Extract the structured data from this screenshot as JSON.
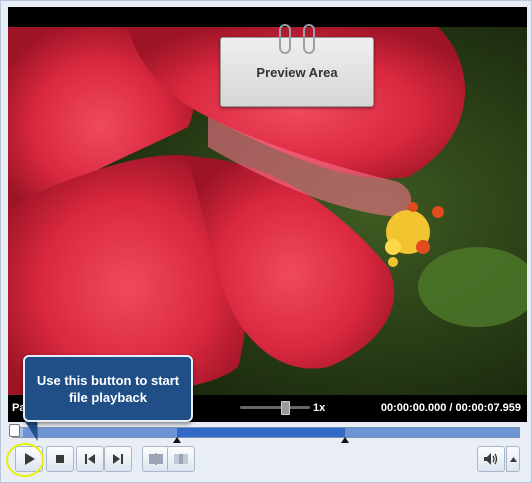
{
  "preview": {
    "label": "Preview Area"
  },
  "status": {
    "left_text": "Pa",
    "speed": "1x",
    "current_time": "00:00:00.000",
    "separator": "/",
    "total_time": "00:00:07.959"
  },
  "tooltip": {
    "text": "Use this button to start file playback"
  },
  "timeline": {
    "progress_fraction": 0.0
  },
  "controls": {
    "play": "play-icon",
    "stop": "stop-icon",
    "prev": "skip-previous-icon",
    "next": "skip-next-icon",
    "split": "split-icon",
    "merge": "merge-icon",
    "volume": "speaker-icon"
  },
  "colors": {
    "highlight": "#e9f200",
    "tooltip_bg": "#1f4f86",
    "timeline_selection": "#3268c6"
  }
}
